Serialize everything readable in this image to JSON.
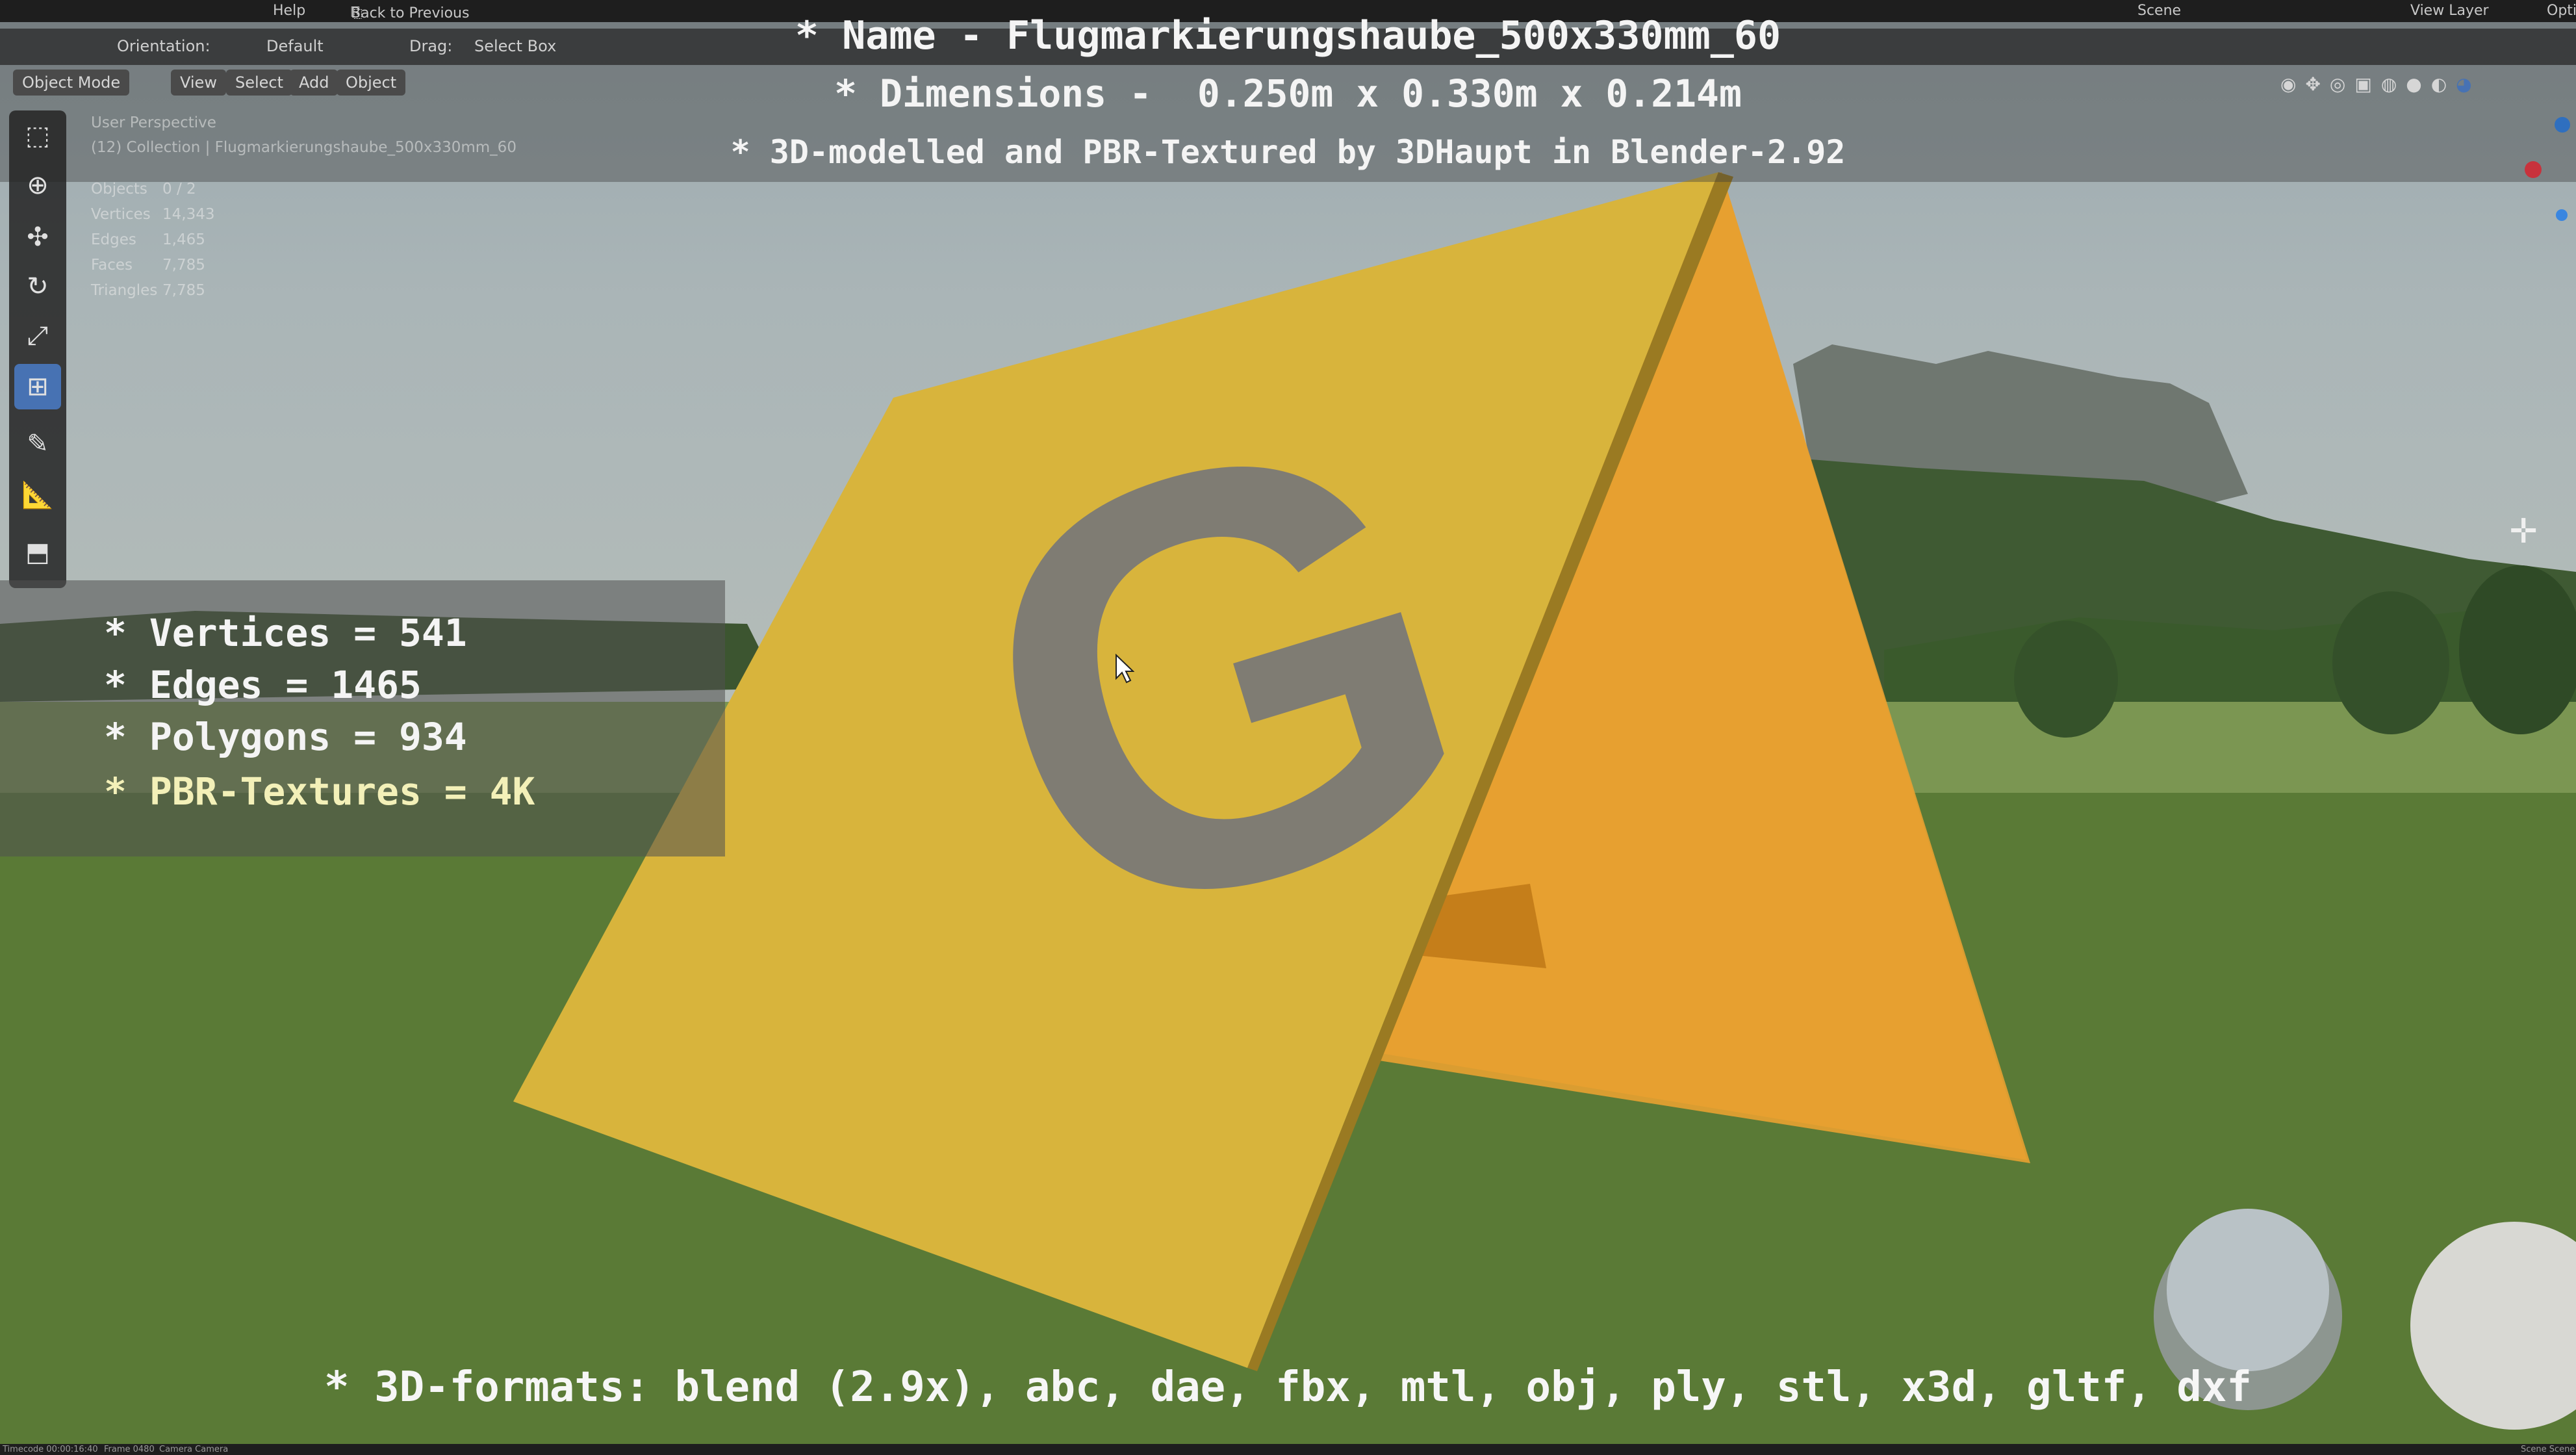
{
  "topbar": {
    "menu_help": "Help",
    "back_to_previous": "Back to Previous",
    "scene": "Scene",
    "view_layer": "View Layer",
    "opt_cut": "Opti"
  },
  "tool_header": {
    "orientation_label": "Orientation:",
    "orientation_value": "Default",
    "drag_label": "Drag:",
    "drag_value": "Select Box"
  },
  "mode_bar": {
    "mode": "Object Mode",
    "view": "View",
    "select": "Select",
    "add": "Add",
    "object": "Object"
  },
  "viewport_info": {
    "perspective": "User Perspective",
    "collection": "(12) Collection | Flugmarkierungshaube_500x330mm_60",
    "stats": [
      {
        "label": "Objects",
        "value": "0 / 2"
      },
      {
        "label": "Vertices",
        "value": "14,343"
      },
      {
        "label": "Edges",
        "value": "1,465"
      },
      {
        "label": "Faces",
        "value": "7,785"
      },
      {
        "label": "Triangles",
        "value": "7,785"
      }
    ]
  },
  "banner": {
    "line1": "* Name - Flugmarkierungshaube_500x330mm_60",
    "line2": "* Dimensions -  0.250m x 0.330m x 0.214m",
    "line3": "* 3D-modelled and PBR-Textured by 3DHaupt in Blender-2.92"
  },
  "stats_box": {
    "vertices": "* Vertices = 541",
    "edges": "* Edges = 1465",
    "polygons": "* Polygons = 934",
    "textures": "* PBR-Textures = 4K"
  },
  "formats": "* 3D-formats: blend (2.9x), abc, dae, fbx, mtl, obj, ply, stl, x3d, gltf, dxf",
  "model_letter": "G",
  "statusbar": {
    "timecode": "Timecode 00:00:16:40",
    "frame": "Frame 0480",
    "camera": "Camera Camera",
    "scene": "Scene Scene"
  },
  "colors": {
    "panel_yellow": "#d9b43a",
    "inner_orange": "#e89a28",
    "accent_blue": "#4772b3",
    "letter_gray": "#7d7b74"
  }
}
